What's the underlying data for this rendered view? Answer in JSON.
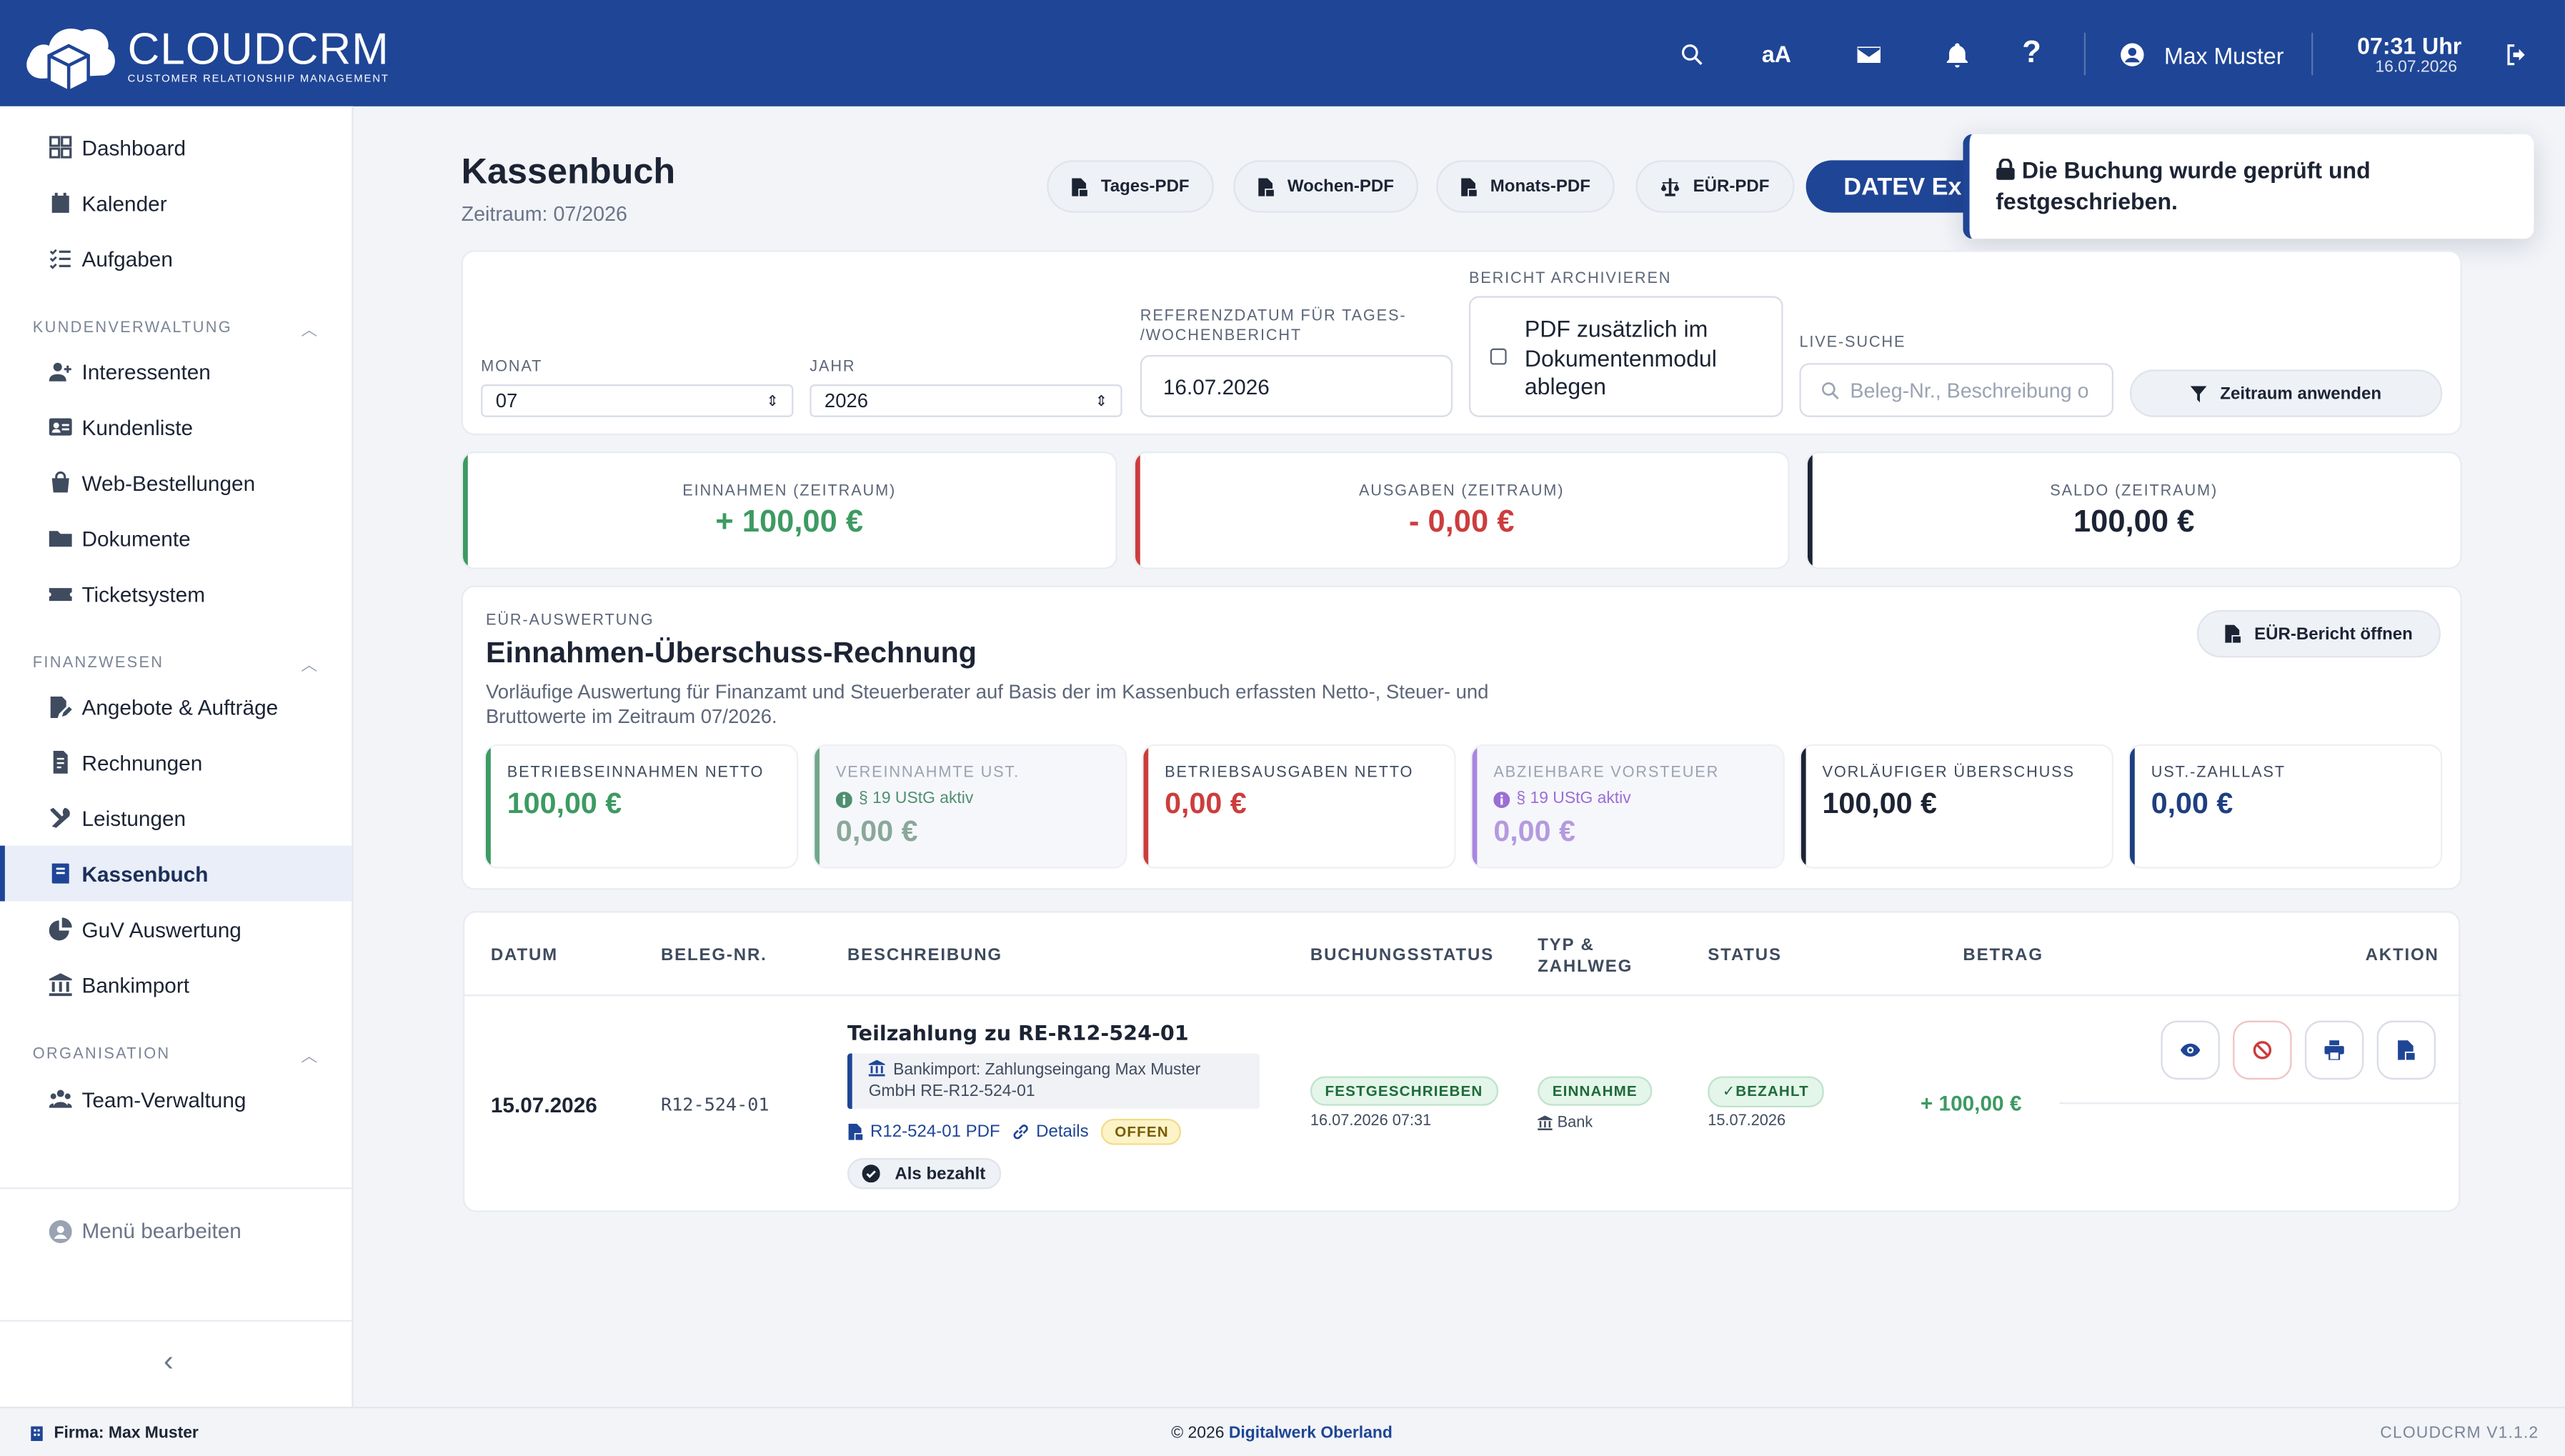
{
  "app": {
    "logo_title": "CLOUDCRM",
    "logo_subtitle": "CUSTOMER RELATIONSHIP MANAGEMENT",
    "user_name": "Max Muster",
    "clock_time": "07:31 Uhr",
    "clock_date": "16.07.2026",
    "font_size_label": "aA"
  },
  "sidebar": {
    "top_items": [
      {
        "label": "Dashboard",
        "icon": "grid-icon"
      },
      {
        "label": "Kalender",
        "icon": "calendar-icon"
      },
      {
        "label": "Aufgaben",
        "icon": "checklist-icon"
      }
    ],
    "sections": [
      {
        "title": "KUNDENVERWALTUNG",
        "items": [
          {
            "label": "Interessenten",
            "icon": "user-plus-icon"
          },
          {
            "label": "Kundenliste",
            "icon": "id-card-icon"
          },
          {
            "label": "Web-Bestellungen",
            "icon": "shopping-bag-icon"
          },
          {
            "label": "Dokumente",
            "icon": "folder-icon"
          },
          {
            "label": "Ticketsystem",
            "icon": "ticket-icon"
          }
        ]
      },
      {
        "title": "FINANZWESEN",
        "items": [
          {
            "label": "Angebote & Aufträge",
            "icon": "file-pen-icon"
          },
          {
            "label": "Rechnungen",
            "icon": "invoice-icon"
          },
          {
            "label": "Leistungen",
            "icon": "tools-icon"
          },
          {
            "label": "Kassenbuch",
            "icon": "book-icon",
            "active": true
          },
          {
            "label": "GuV Auswertung",
            "icon": "pie-chart-icon"
          },
          {
            "label": "Bankimport",
            "icon": "bank-icon"
          }
        ]
      },
      {
        "title": "ORGANISATION",
        "items": [
          {
            "label": "Team-Verwaltung",
            "icon": "users-icon"
          }
        ]
      }
    ],
    "menu_edit_label": "Menü bearbeiten",
    "collapse_label": "‹"
  },
  "page": {
    "title": "Kassenbuch",
    "subtitle": "Zeitraum: 07/2026",
    "pdf_buttons": [
      "Tages-PDF",
      "Wochen-PDF",
      "Monats-PDF",
      "EÜR-PDF"
    ],
    "datev_label": "DATEV Exp",
    "toast": "Die Buchung wurde geprüft und festgeschrieben."
  },
  "filters": {
    "month_label": "MONAT",
    "month_value": "07",
    "year_label": "JAHR",
    "year_value": "2026",
    "refdate_label": "REFERENZDATUM FÜR TAGES- /WOCHENBERICHT",
    "refdate_value": "16.07.2026",
    "archive_label": "BERICHT ARCHIVIEREN",
    "archive_text": "PDF zusätzlich im Dokumentenmodul ablegen",
    "search_label": "LIVE-SUCHE",
    "search_placeholder": "Beleg-Nr., Beschreibung o",
    "apply_label": "Zeitraum anwenden"
  },
  "summary": [
    {
      "label": "EINNAHMEN (ZEITRAUM)",
      "value": "+ 100,00 €",
      "color": "#3d9a62"
    },
    {
      "label": "AUSGABEN (ZEITRAUM)",
      "value": "- 0,00 €",
      "color": "#cc3d3d"
    },
    {
      "label": "SALDO (ZEITRAUM)",
      "value": "100,00 €",
      "color": "#1c2434"
    }
  ],
  "eur": {
    "kicker": "EÜR-AUSWERTUNG",
    "title": "Einnahmen-Überschuss-Rechnung",
    "description": "Vorläufige Auswertung für Finanzamt und Steuerberater auf Basis der im Kassenbuch erfassten Netto-, Steuer- und Bruttowerte im Zeitraum 07/2026.",
    "open_label": "EÜR-Bericht öffnen",
    "kpis": [
      {
        "label": "BETRIEBSEINNAHMEN NETTO",
        "value": "100,00 €",
        "note": "",
        "color": "#3d9a62"
      },
      {
        "label": "VEREINNAHMTE UST.",
        "value": "0,00 €",
        "note": "§ 19 UStG aktiv",
        "color": "#4f8f70"
      },
      {
        "label": "BETRIEBSAUSGABEN NETTO",
        "value": "0,00 €",
        "note": "",
        "color": "#cc3d3d"
      },
      {
        "label": "ABZIEHBARE VORSTEUER",
        "value": "0,00 €",
        "note": "§ 19 UStG aktiv",
        "color": "#9a6ed6"
      },
      {
        "label": "VORLÄUFIGER ÜBERSCHUSS",
        "value": "100,00 €",
        "note": "",
        "color": "#1c2434"
      },
      {
        "label": "UST.-ZAHLLAST",
        "value": "0,00 €",
        "note": "",
        "color": "#1f3f80"
      }
    ]
  },
  "table": {
    "headers": [
      "DATUM",
      "BELEG-NR.",
      "BESCHREIBUNG",
      "BUCHUNGSSTATUS",
      "TYP & ZAHLWEG",
      "STATUS",
      "BETRAG",
      "AKTION"
    ],
    "row": {
      "date": "15.07.2026",
      "beleg": "R12-524-01",
      "title": "Teilzahlung zu RE-R12-524-01",
      "import_text": "Bankimport: Zahlungseingang Max Muster GmbH RE-R12-524-01",
      "pdf_link": "R12-524-01 PDF",
      "details_link": "Details",
      "open_badge": "OFFEN",
      "paid_button": "Als bezahlt",
      "booking_status": "FESTGESCHRIEBEN",
      "booking_date": "16.07.2026 07:31",
      "type": "EINNAHME",
      "payment_method": "Bank",
      "status": "✓BEZAHLT",
      "status_date": "15.07.2026",
      "amount": "+ 100,00 €"
    }
  },
  "footer": {
    "firm": "Firma: Max Muster",
    "copyright": "© 2026",
    "company": "Digitalwerk Oberland",
    "version": "CLOUDCRM V1.1.2"
  }
}
